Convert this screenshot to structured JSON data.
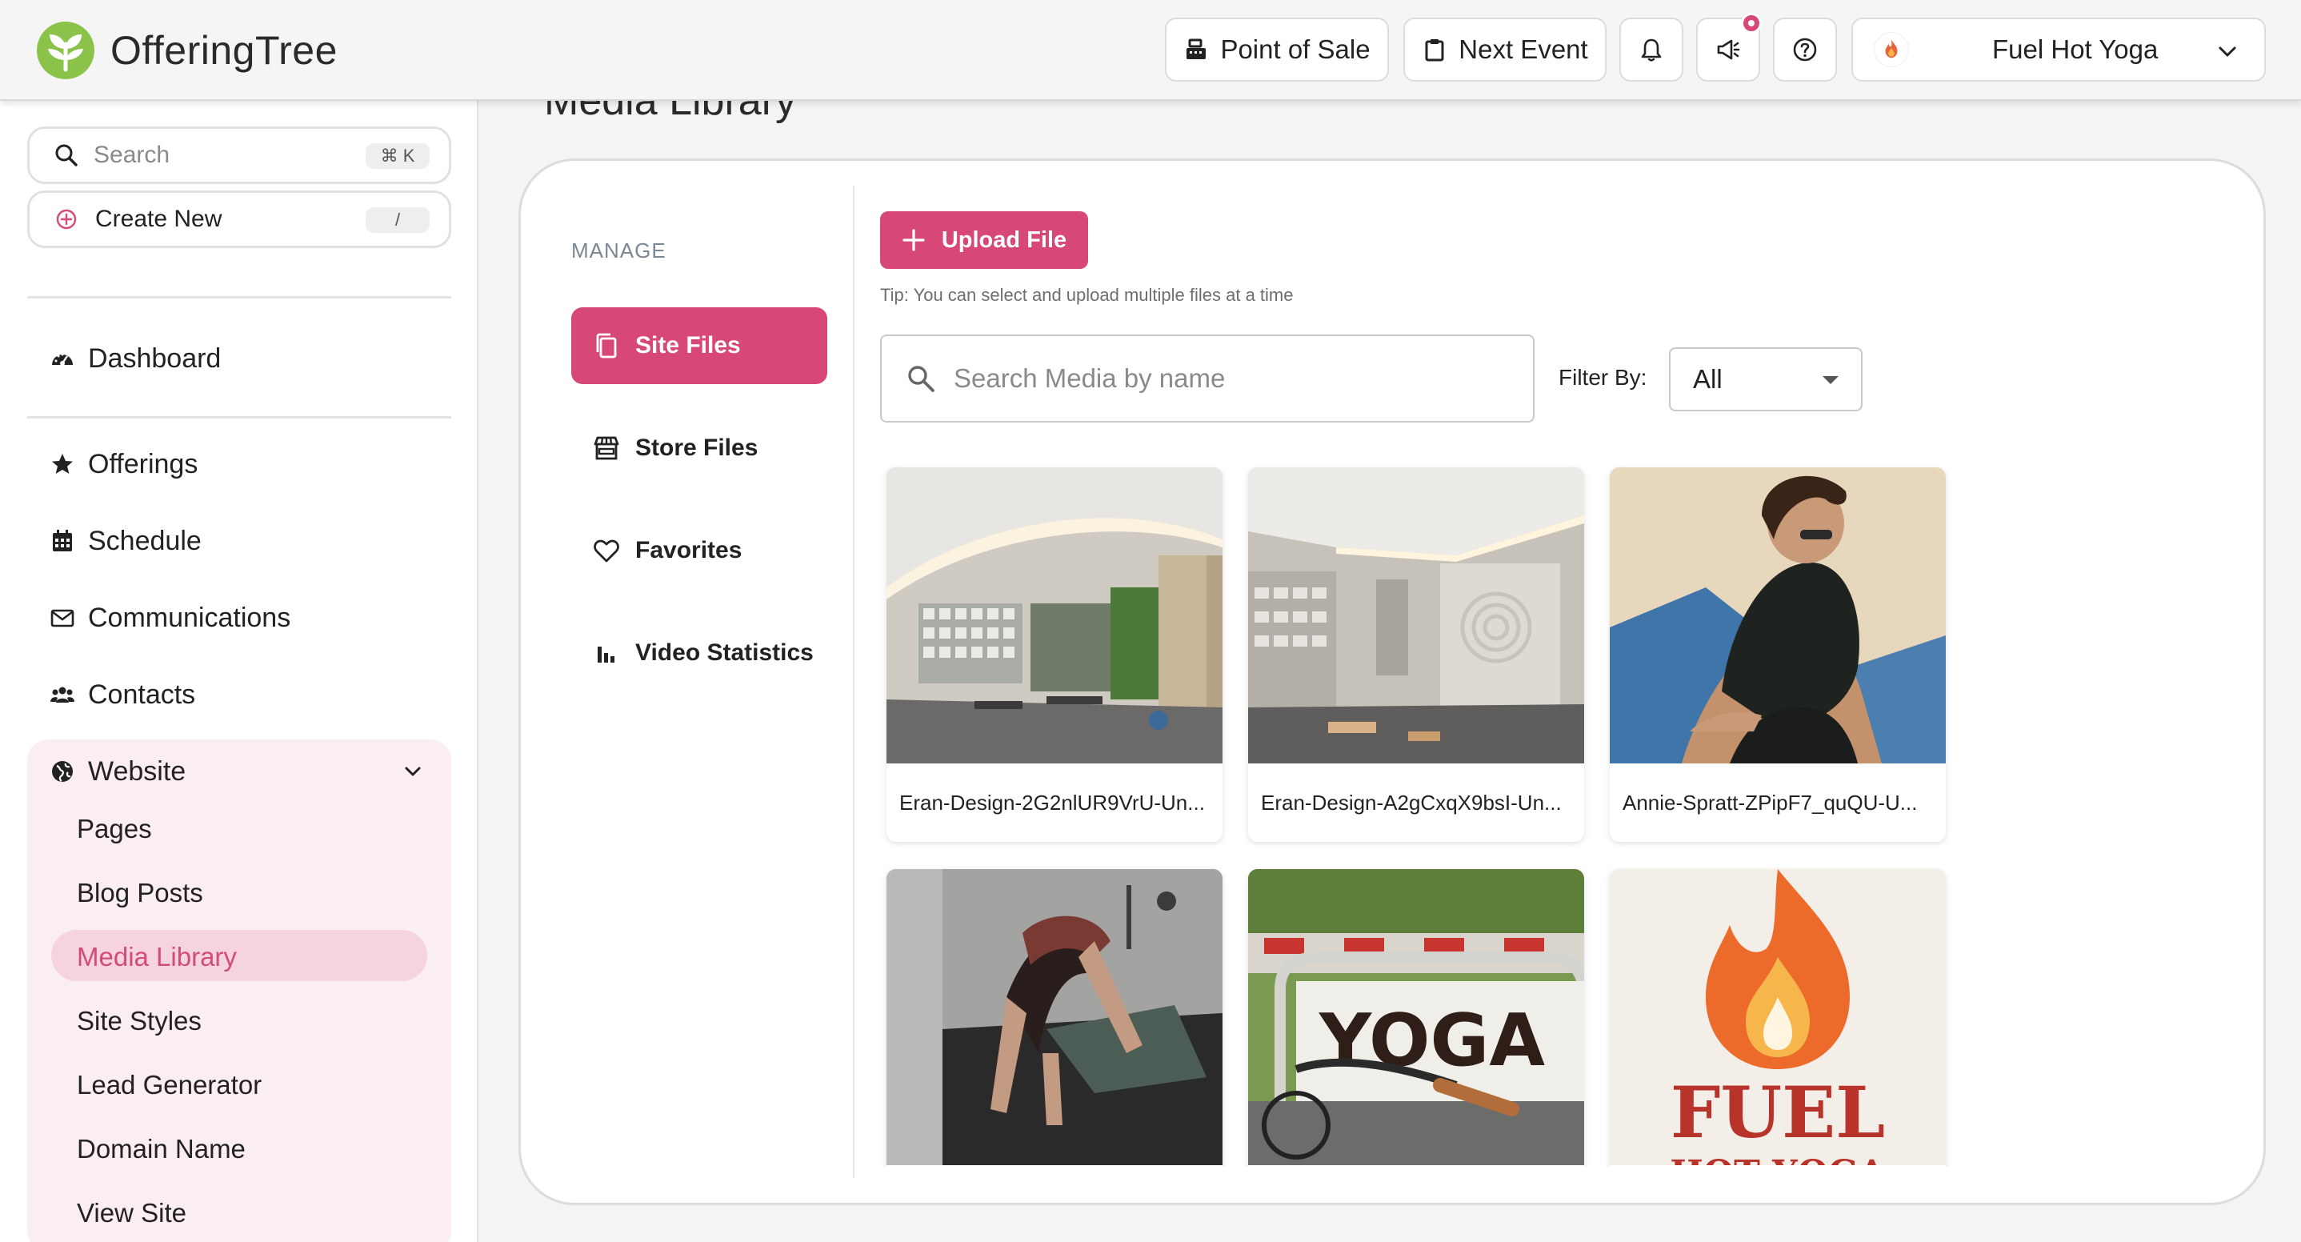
{
  "app": {
    "name": "OfferingTree"
  },
  "header": {
    "pos_label": "Point of Sale",
    "next_event_label": "Next Event",
    "account_name": "Fuel Hot Yoga"
  },
  "sidebar": {
    "search_placeholder": "Search",
    "search_shortcut": "⌘ K",
    "create_label": "Create New",
    "create_shortcut": "/",
    "items": [
      {
        "label": "Dashboard",
        "icon": "dashboard-icon"
      },
      {
        "label": "Offerings",
        "icon": "star-icon"
      },
      {
        "label": "Schedule",
        "icon": "calendar-icon"
      },
      {
        "label": "Communications",
        "icon": "mail-icon"
      },
      {
        "label": "Contacts",
        "icon": "users-icon"
      },
      {
        "label": "Website",
        "icon": "globe-icon"
      }
    ],
    "website_subitems": [
      {
        "label": "Pages"
      },
      {
        "label": "Blog Posts"
      },
      {
        "label": "Media Library"
      },
      {
        "label": "Site Styles"
      },
      {
        "label": "Lead Generator"
      },
      {
        "label": "Domain Name"
      },
      {
        "label": "View Site"
      }
    ]
  },
  "main": {
    "title": "Media Library",
    "manage_label": "MANAGE",
    "manage_items": [
      {
        "label": "Site Files",
        "icon": "files-icon"
      },
      {
        "label": "Store Files",
        "icon": "store-icon"
      },
      {
        "label": "Favorites",
        "icon": "heart-icon"
      },
      {
        "label": "Video Statistics",
        "icon": "bar-chart-icon"
      }
    ],
    "upload_label": "Upload File",
    "tip": "Tip: You can select and upload multiple files at a time",
    "search_placeholder": "Search Media by name",
    "filter_label": "Filter By:",
    "filter_value": "All",
    "files": [
      {
        "name": "Eran-Design-2G2nlUR9VrU-Un..."
      },
      {
        "name": "Eran-Design-A2gCxqX9bsI-Un..."
      },
      {
        "name": "Annie-Spratt-ZPipF7_quQU-U..."
      },
      {
        "name": ""
      },
      {
        "name": "",
        "sign_text": "YOGA"
      },
      {
        "name": "",
        "logo_text": "FUEL",
        "logo_subtext": "HOT YOGA"
      }
    ]
  },
  "colors": {
    "accent": "#d84876",
    "accent_soft": "#fbeef2",
    "logo_green": "#8bc34a"
  }
}
